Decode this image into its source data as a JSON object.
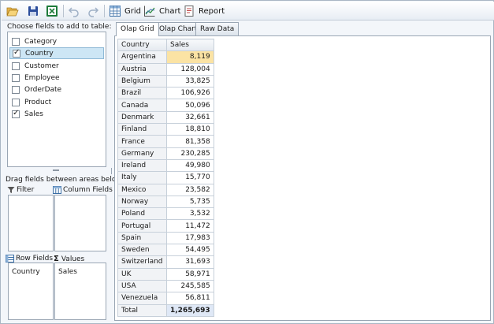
{
  "toolbar": {
    "icons": [
      "folder-open-icon",
      "save-icon",
      "excel-export-icon",
      "undo-icon",
      "redo-icon"
    ],
    "grid_label": "Grid",
    "chart_label": "Chart",
    "report_label": "Report"
  },
  "left_panel": {
    "choose_label": "Choose fields to add to table:",
    "fields": [
      {
        "label": "Category",
        "checked": false
      },
      {
        "label": "Country",
        "checked": true
      },
      {
        "label": "Customer",
        "checked": false
      },
      {
        "label": "Employee",
        "checked": false
      },
      {
        "label": "OrderDate",
        "checked": false
      },
      {
        "label": "Product",
        "checked": false
      },
      {
        "label": "Sales",
        "checked": true
      }
    ],
    "drag_label": "Drag fields between areas below:",
    "filter_label": "Filter",
    "column_fields_label": "Column Fields",
    "row_fields_label": "Row Fields",
    "values_label": "Values",
    "row_fields_items": [
      "Country"
    ],
    "values_items": [
      "Sales"
    ]
  },
  "tabs": [
    {
      "label": "Olap Grid",
      "active": true
    },
    {
      "label": "Olap Chart",
      "active": false
    },
    {
      "label": "Raw Data",
      "active": false
    }
  ],
  "grid": {
    "header_row": "Country",
    "header_value": "Sales",
    "rows": [
      {
        "country": "Argentina",
        "sales": "8,119"
      },
      {
        "country": "Austria",
        "sales": "128,004"
      },
      {
        "country": "Belgium",
        "sales": "33,825"
      },
      {
        "country": "Brazil",
        "sales": "106,926"
      },
      {
        "country": "Canada",
        "sales": "50,096"
      },
      {
        "country": "Denmark",
        "sales": "32,661"
      },
      {
        "country": "Finland",
        "sales": "18,810"
      },
      {
        "country": "France",
        "sales": "81,358"
      },
      {
        "country": "Germany",
        "sales": "230,285"
      },
      {
        "country": "Ireland",
        "sales": "49,980"
      },
      {
        "country": "Italy",
        "sales": "15,770"
      },
      {
        "country": "Mexico",
        "sales": "23,582"
      },
      {
        "country": "Norway",
        "sales": "5,735"
      },
      {
        "country": "Poland",
        "sales": "3,532"
      },
      {
        "country": "Portugal",
        "sales": "11,472"
      },
      {
        "country": "Spain",
        "sales": "17,983"
      },
      {
        "country": "Sweden",
        "sales": "54,495"
      },
      {
        "country": "Switzerland",
        "sales": "31,693"
      },
      {
        "country": "UK",
        "sales": "58,971"
      },
      {
        "country": "USA",
        "sales": "245,585"
      },
      {
        "country": "Venezuela",
        "sales": "56,811"
      }
    ],
    "total_label": "Total",
    "total_value": "1,265,693"
  },
  "colors": {
    "selected_cell": "#fbe3a4",
    "total_cell": "#dfe8f6",
    "selected_field": "#cde6f5"
  }
}
